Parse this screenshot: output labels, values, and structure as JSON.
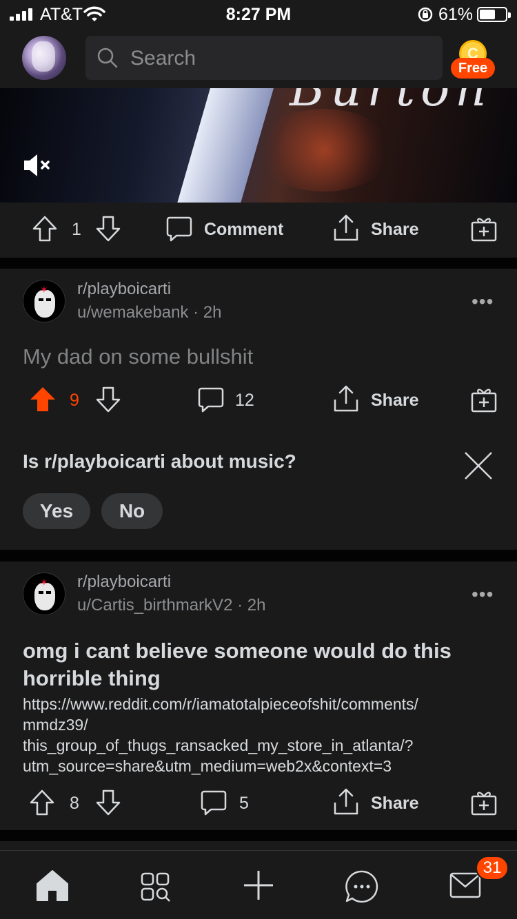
{
  "status_bar": {
    "carrier": "AT&T",
    "time": "8:27 PM",
    "battery": "61%",
    "battery_level": 0.61
  },
  "header": {
    "search_placeholder": "Search",
    "coin_letter": "C",
    "free_label": "Free"
  },
  "media_post": {
    "script_text": "Burton",
    "vote_count": "1",
    "comment_label": "Comment",
    "share_label": "Share"
  },
  "posts": [
    {
      "subreddit": "r/playboicarti",
      "user": "u/wemakebank",
      "age": "2h",
      "more": "•••",
      "title": "My dad on some bullshit",
      "votes": "9",
      "upvoted": true,
      "comments": "12",
      "share_label": "Share"
    },
    {
      "subreddit": "r/playboicarti",
      "user": "u/Cartis_birthmarkV2",
      "age": "2h",
      "more": "•••",
      "title": "omg i cant believe someone would do this horrible thing",
      "link_lines": [
        "https://www.reddit.com/r/iamatotalpieceofshit/comments/",
        "mmdz39/",
        "this_group_of_thugs_ransacked_my_store_in_atlanta/?",
        "utm_source=share&utm_medium=web2x&context=3"
      ],
      "votes": "8",
      "upvoted": false,
      "comments": "5",
      "share_label": "Share"
    }
  ],
  "survey": {
    "question": "Is r/playboicarti about music?",
    "yes_label": "Yes",
    "no_label": "No"
  },
  "tabbar": {
    "inbox_badge": "31"
  },
  "colors": {
    "accent_orange": "#ff4500",
    "card_bg": "#1a1a1b",
    "feed_bg": "#030303",
    "text_primary": "#d7dadc",
    "text_muted": "#8b8d90"
  },
  "icons": [
    "search-icon",
    "mute-icon",
    "upvote-icon",
    "downvote-icon",
    "comment-icon",
    "share-icon",
    "award-icon",
    "close-icon",
    "home-icon",
    "communities-icon",
    "create-post-icon",
    "chat-icon",
    "inbox-icon"
  ]
}
